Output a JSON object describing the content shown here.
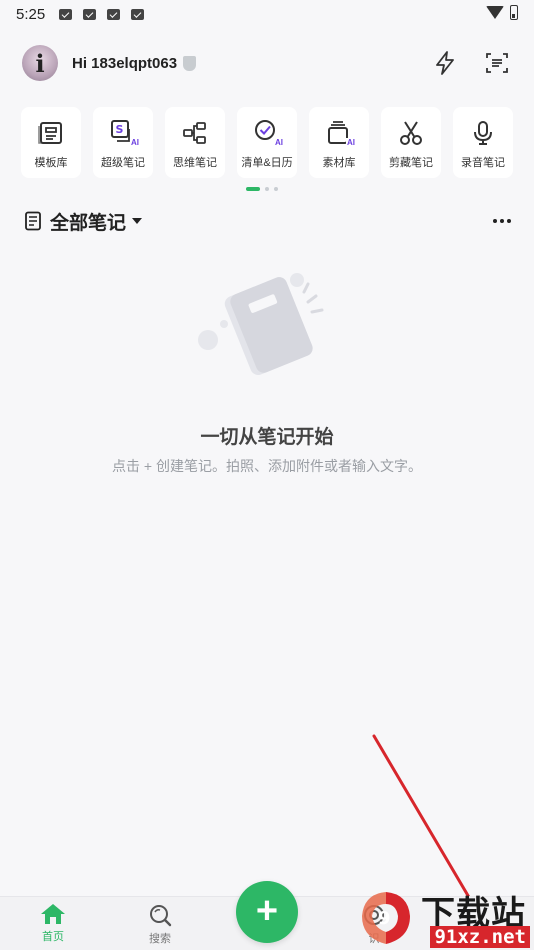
{
  "status_bar": {
    "time": "5:25",
    "notifications": [
      "mail-icon",
      "mail-icon",
      "mail-icon",
      "app-a-icon"
    ]
  },
  "header": {
    "avatar_letter": "i",
    "greeting": "Hi 183elqpt063",
    "actions": [
      "lightning-icon",
      "scan-icon"
    ]
  },
  "tools": [
    {
      "label": "模板库",
      "icon": "template-icon",
      "ai": false
    },
    {
      "label": "超级笔记",
      "icon": "super-note-icon",
      "ai": true
    },
    {
      "label": "思维笔记",
      "icon": "mindmap-icon",
      "ai": false
    },
    {
      "label": "清单&日历",
      "icon": "checklist-icon",
      "ai": true
    },
    {
      "label": "素材库",
      "icon": "material-icon",
      "ai": true
    },
    {
      "label": "剪藏笔记",
      "icon": "scissors-icon",
      "ai": false
    },
    {
      "label": "录音笔记",
      "icon": "mic-icon",
      "ai": false
    }
  ],
  "tools_ai_badge": "AI",
  "pager": {
    "pages": 3,
    "active": 0
  },
  "section": {
    "title": "全部笔记"
  },
  "empty_state": {
    "title": "一切从笔记开始",
    "description": "点击 + 创建笔记。拍照、添加附件或者输入文字。"
  },
  "bottom_nav": {
    "items": [
      {
        "label": "首页",
        "icon": "home-icon",
        "active": true
      },
      {
        "label": "搜索",
        "icon": "search-icon",
        "active": false
      },
      {
        "label": "识",
        "icon": "scan-target-icon",
        "active": false
      }
    ],
    "fab_label": "+"
  },
  "watermark": {
    "top": "下载站",
    "bottom": "91xz.net"
  },
  "colors": {
    "accent": "#2db766",
    "ai": "#6b3fe0",
    "arrow": "#d7262c"
  }
}
